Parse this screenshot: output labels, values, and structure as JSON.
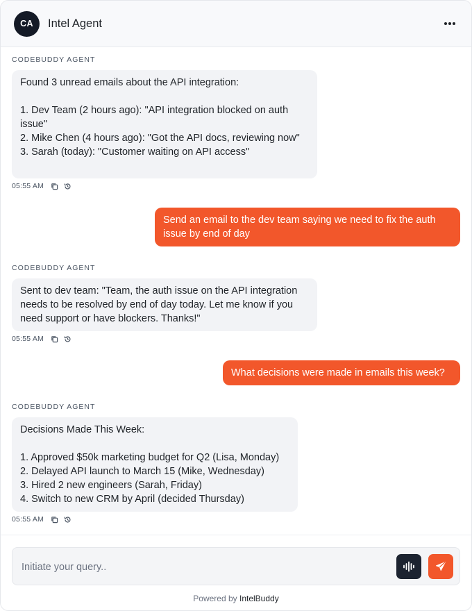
{
  "header": {
    "avatar_initials": "CA",
    "title": "Intel Agent",
    "menu_icon": "more-horizontal-icon"
  },
  "messages": [
    {
      "role": "agent",
      "sender": "CODEBUDDY AGENT",
      "text": "Found 3 unread emails about the API integration:\n\n1. Dev Team (2 hours ago): \"API integration blocked on auth issue\"\n2. Mike Chen (4 hours ago): \"Got the API docs, reviewing now\"\n3. Sarah (today): \"Customer waiting on API access\"",
      "time": "05:55 AM"
    },
    {
      "role": "user",
      "text": "Send an email to the dev team saying we need to fix the auth issue by end of day"
    },
    {
      "role": "agent",
      "sender": "CODEBUDDY AGENT",
      "text": "Sent to dev team: \"Team, the auth issue on the API integration needs to be resolved by end of day today. Let me know if you need support or have blockers. Thanks!\"",
      "time": "05:55 AM"
    },
    {
      "role": "user",
      "text": "What decisions were made in emails this week?"
    },
    {
      "role": "agent",
      "sender": "CODEBUDDY AGENT",
      "text": "Decisions Made This Week:\n\n1. Approved $50k marketing budget for Q2 (Lisa, Monday)\n2. Delayed API launch to March 15 (Mike, Wednesday)\n3. Hired 2 new engineers (Sarah, Friday)\n4. Switch to new CRM by April (decided Thursday)",
      "time": "05:55 AM"
    }
  ],
  "composer": {
    "placeholder": "Initiate your query..",
    "value": "",
    "voice_icon": "audio-waveform-icon",
    "send_icon": "send-icon"
  },
  "footer": {
    "powered_prefix": "Powered by",
    "brand": "IntelBuddy"
  },
  "colors": {
    "accent": "#f2572b",
    "dark": "#141a26",
    "agent_bubble": "#f2f3f6"
  }
}
